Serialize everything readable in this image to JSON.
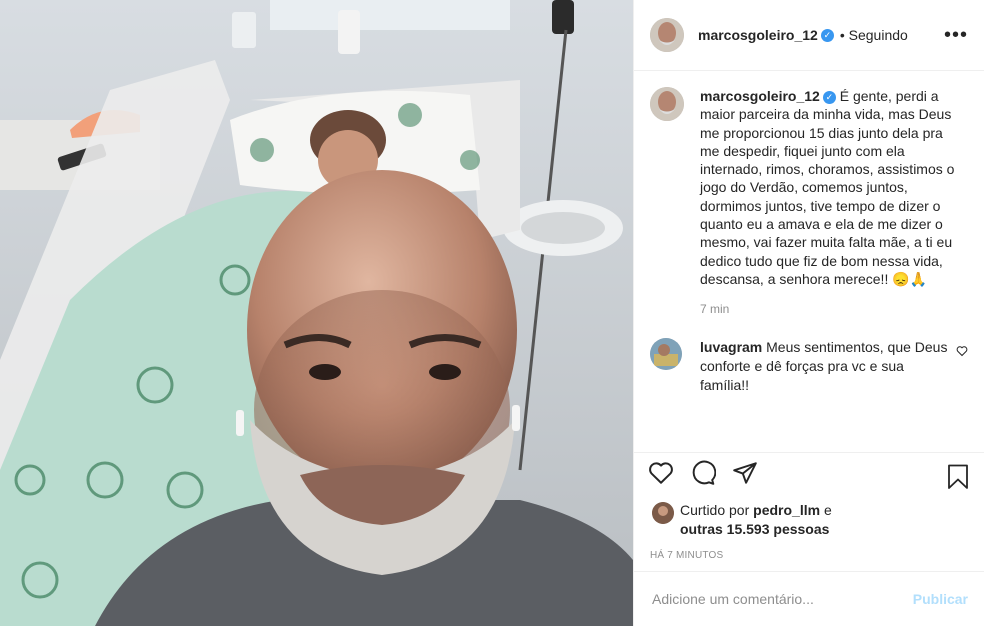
{
  "post": {
    "author": "marcosgoleiro_12",
    "follow_status": "Seguindo",
    "more_icon": "more-options-icon",
    "verified_icon": "verified-badge-icon",
    "caption": "É gente, perdi a maior parceira da minha vida, mas Deus me proporcionou 15 dias junto dela pra me despedir, fiquei junto com ela internado, rimos, choramos, assistimos o jogo do Verdão, comemos juntos, dormimos juntos, tive tempo de dizer o quanto eu a amava e ela de me dizer o mesmo, vai fazer muita falta mãe, a ti eu dedico tudo que fiz de bom nessa vida, descansa, a senhora merece!! 😞🙏",
    "caption_time": "7 min"
  },
  "comments": [
    {
      "user": "luvagram",
      "text": "Meus sentimentos, que Deus conforte e dê forças pra vc e sua família!!"
    }
  ],
  "likes": {
    "prefix": "Curtido por",
    "user": "pedro_llm",
    "and": "e",
    "others": "outras 15.593 pessoas"
  },
  "age": "HÁ 7 MINUTOS",
  "add_comment": {
    "placeholder": "Adicione um comentário...",
    "publish_label": "Publicar"
  },
  "colors": {
    "verified": "#3897f0",
    "publish_disabled": "#b2dffc",
    "muted_text": "#8e8e8e"
  }
}
